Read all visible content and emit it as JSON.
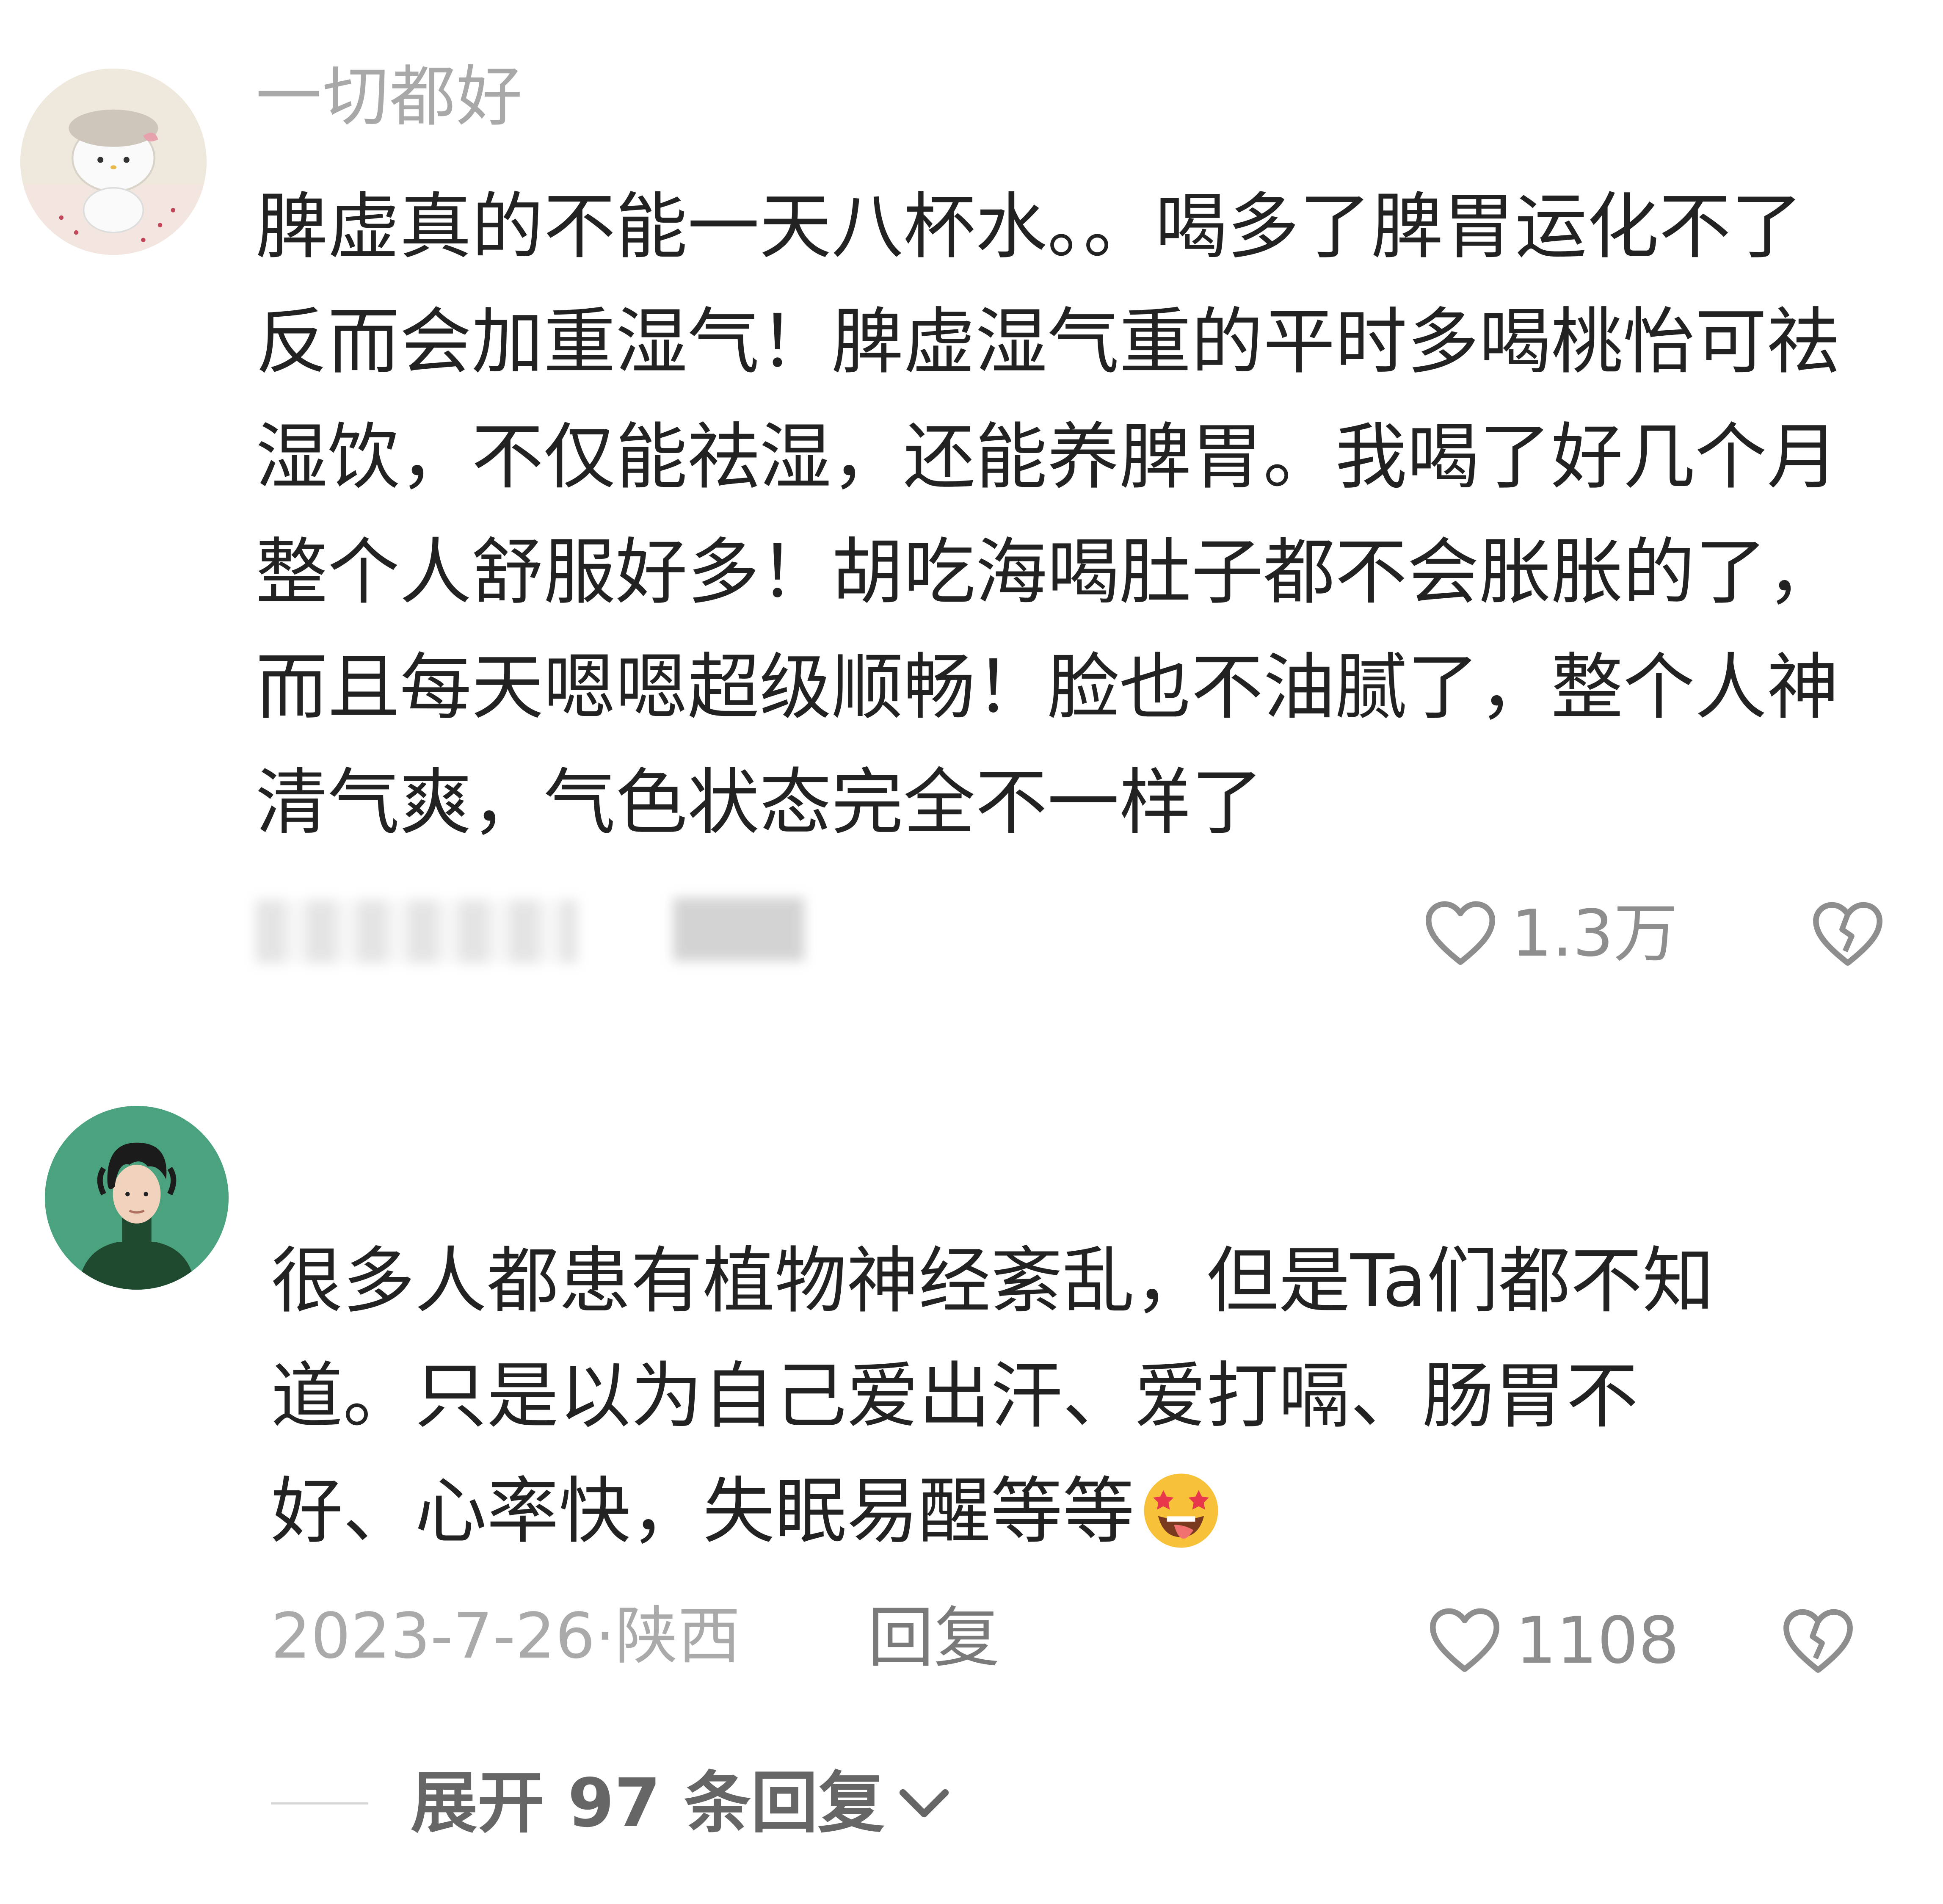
{
  "comments": [
    {
      "username": "一切都好",
      "avatar_icon": "hello-kitty-avatar",
      "lines": [
        "脾虚真的不能一天八杯水。。喝多了脾胃运化不了",
        "反而会加重湿气！脾虚湿气重的平时多喝桃怡可祛",
        "湿饮，不仅能祛湿，还能养脾胃。我喝了好几个月",
        "整个人舒服好多！胡吃海喝肚子都不会胀胀的了，",
        "而且每天嗯嗯超级顺畅！脸也不油腻了，整个人神",
        "清气爽，气色状态完全不一样了"
      ],
      "like_count": "1.3万"
    },
    {
      "avatar_icon": "curly-hair-man-avatar",
      "lines": [
        "很多人都患有植物神经紊乱，但是Ta们都不知",
        "道。只是以为自己爱出汗、爱打嗝、肠胃不",
        "好、心率快，失眠易醒等等"
      ],
      "emoji_icon": "star-struck-tongue-emoji",
      "date": "2023-7-26",
      "separator": "·",
      "location": "陕西",
      "reply_label": "回复",
      "like_count": "1108",
      "expand_label": "展开 97 条回复"
    }
  ],
  "colors": {
    "text_primary": "#222222",
    "text_secondary": "#a8a8a8",
    "icon_gray": "#8e8e8e",
    "avatar_green": "#4aa27e"
  }
}
